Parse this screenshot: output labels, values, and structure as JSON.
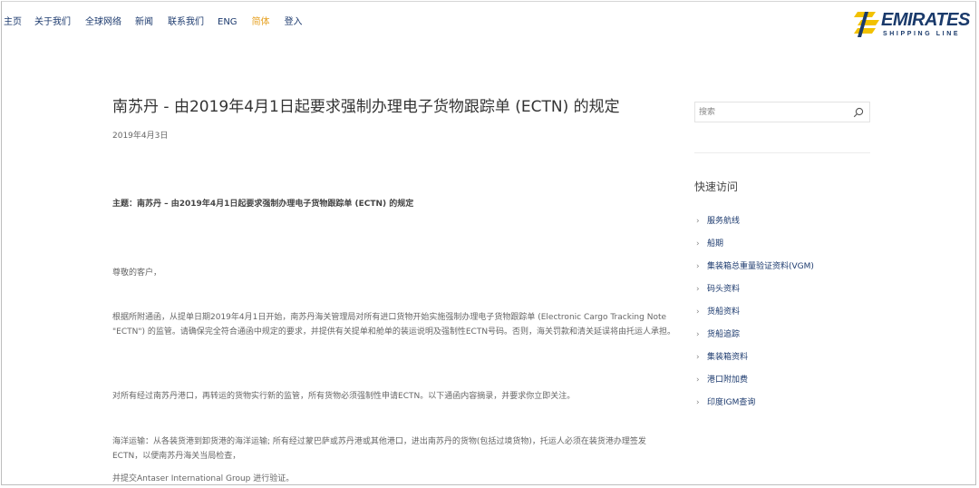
{
  "nav": {
    "items": [
      {
        "label": "主页",
        "active": false
      },
      {
        "label": "关于我们",
        "active": false
      },
      {
        "label": "全球网络",
        "active": false
      },
      {
        "label": "新闻",
        "active": false
      },
      {
        "label": "联系我们",
        "active": false
      },
      {
        "label": "ENG",
        "active": false
      },
      {
        "label": "简体",
        "active": true
      },
      {
        "label": "登入",
        "active": false
      }
    ]
  },
  "logo": {
    "name": "EMIRATES",
    "tagline": "SHIPPING LINE",
    "brand_color": "#1a3a6b",
    "accent_color": "#f2c100"
  },
  "article": {
    "title": "南苏丹 - 由2019年4月1日起要求强制办理电子货物跟踪单 (ECTN) 的规定",
    "date": "2019年4月3日",
    "subject": "主题：南苏丹 – 由2019年4月1日起要求强制办理电子货物跟踪单 (ECTN) 的规定",
    "greeting": "尊敬的客户，",
    "p1": "根据所附通函，从提单日期2019年4月1日开始，南苏丹海关管理局对所有进口货物开始实施强制办理电子货物跟踪单 (Electronic Cargo Tracking Note \"ECTN\") 的监管。请确保完全符合通函中规定的要求，并提供有关提单和舱单的装运说明及强制性ECTN号码。否则，海关罚款和清关延误将由托运人承担。",
    "p2": "对所有经过南苏丹港口，再转运的货物实行新的监管，所有货物必须强制性申请ECTN。以下通函内容摘录，并要求你立即关注。",
    "p3": "海洋运输：从各装货港到卸货港的海洋运输; 所有经过蒙巴萨或苏丹港或其他港口，进出南苏丹的货物(包括过境货物)，托运人必须在装货港办理签发ECTN，以便南苏丹海关当局检查，",
    "p4": "并提交Antaser International Group 进行验证。"
  },
  "sidebar": {
    "search_placeholder": "搜索",
    "quick_title": "快速访问",
    "links": [
      "服务航线",
      "船期",
      "集装箱总重量验证资料(VGM)",
      "码头资料",
      "货船资料",
      "货船追踪",
      "集装箱资料",
      "港口附加费",
      "印度IGM查询"
    ]
  },
  "colors": {
    "nav_link": "#1c3a6e",
    "nav_active": "#e6a020",
    "text": "#666666"
  }
}
